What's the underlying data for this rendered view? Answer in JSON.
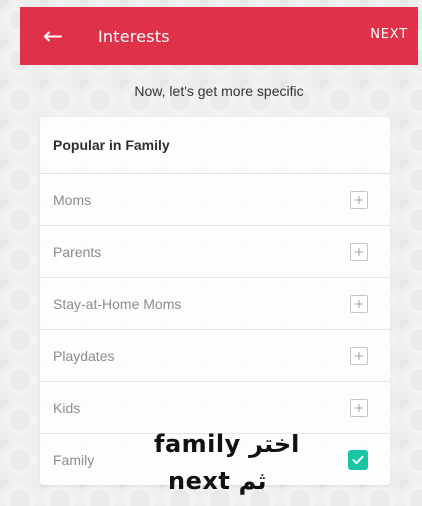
{
  "header": {
    "title": "Interests",
    "back_icon": "back-arrow-icon",
    "next_label": "NEXT",
    "accent_color": "#df3148"
  },
  "subtitle": "Now, let's get more specific",
  "section": {
    "title": "Popular in Family",
    "items": [
      {
        "label": "Moms",
        "state": "add"
      },
      {
        "label": "Parents",
        "state": "add"
      },
      {
        "label": "Stay-at-Home Moms",
        "state": "add"
      },
      {
        "label": "Playdates",
        "state": "add"
      },
      {
        "label": "Kids",
        "state": "add"
      },
      {
        "label": "Family",
        "state": "checked"
      }
    ]
  },
  "overlay": {
    "line1": "اختر family",
    "line2": "ثم next"
  },
  "colors": {
    "checked": "#17c7a3"
  }
}
